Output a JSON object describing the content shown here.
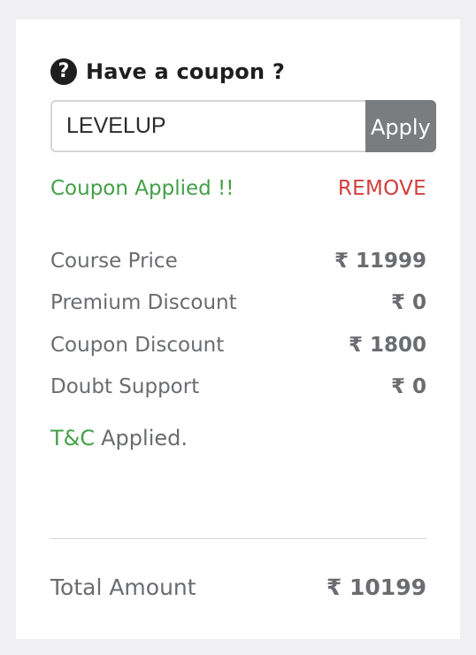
{
  "coupon": {
    "title": "Have a coupon ?",
    "icon": "question-circle-icon",
    "input_value": "LEVELUP",
    "apply_label": "Apply",
    "applied_message": "Coupon Applied !!",
    "remove_label": "REMOVE"
  },
  "prices": [
    {
      "label": "Course Price",
      "value": "₹ 11999"
    },
    {
      "label": "Premium Discount",
      "value": "₹ 0"
    },
    {
      "label": "Coupon Discount",
      "value": "₹ 1800"
    },
    {
      "label": "Doubt Support",
      "value": "₹ 0"
    }
  ],
  "terms": {
    "link_label": "T&C",
    "suffix": "Applied."
  },
  "total": {
    "label": "Total Amount",
    "value": "₹ 10199"
  },
  "colors": {
    "success_green": "#43a047",
    "remove_red": "#d23f3f",
    "apply_button_bg": "#7a7c80",
    "text_gray": "#6a6c70",
    "background": "#f0f0f2"
  }
}
